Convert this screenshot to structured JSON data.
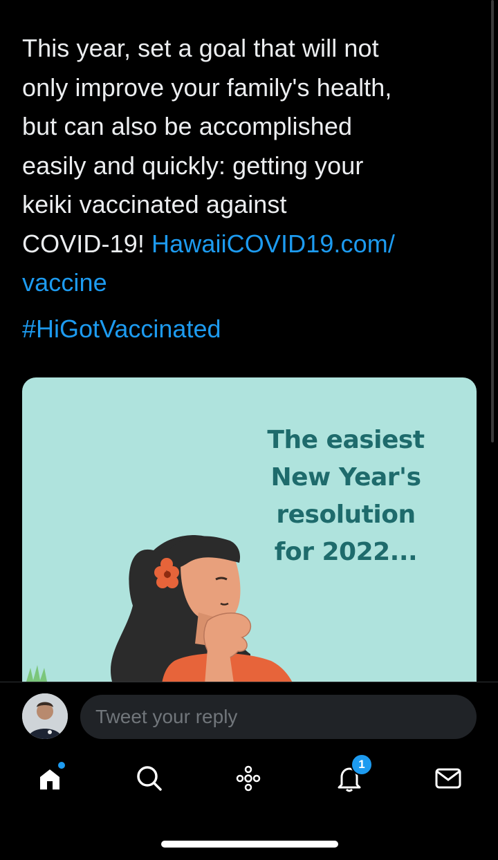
{
  "tweet": {
    "text_lines": [
      "This year, set a goal that will not",
      "only improve your family's health,",
      "but can also be accomplished",
      "easily and quickly: getting your",
      "keiki vaccinated against",
      "COVID-19! "
    ],
    "link_part1": "HawaiiCOVID19.com/",
    "link_part2": "vaccine",
    "hashtag": "#HiGotVaccinated"
  },
  "media": {
    "headline_lines": [
      "The easiest",
      "New Year's",
      "resolution",
      "for 2022..."
    ],
    "background_color": "#afe3dd",
    "headline_color": "#1e6b6c"
  },
  "reply": {
    "placeholder": "Tweet your reply"
  },
  "tabs": {
    "home_icon": "home-icon",
    "search_icon": "search-icon",
    "spaces_icon": "spaces-icon",
    "notifications_icon": "bell-icon",
    "notifications_count": "1",
    "messages_icon": "mail-icon"
  },
  "colors": {
    "accent": "#1d9bf0",
    "background": "#000000"
  }
}
